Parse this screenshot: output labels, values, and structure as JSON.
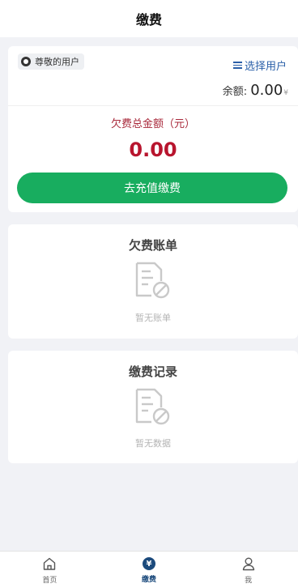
{
  "header": {
    "title": "缴费"
  },
  "account": {
    "user_name": "尊敬的用户",
    "select_user_label": "选择用户",
    "balance_label": "余额:",
    "balance_value": "0.00",
    "balance_unit": "¥",
    "arrears_label": "欠费总金额（元）",
    "arrears_value": "0.00",
    "pay_button_label": "去充值缴费"
  },
  "bills": {
    "title": "欠费账单",
    "empty_text": "暂无账单",
    "icon": "empty-document-icon"
  },
  "records": {
    "title": "缴费记录",
    "empty_text": "暂无数据",
    "icon": "empty-document-icon"
  },
  "tabbar": {
    "items": [
      {
        "label": "首页",
        "icon": "home-icon",
        "active": false
      },
      {
        "label": "缴费",
        "icon": "yen-icon",
        "active": true
      },
      {
        "label": "我",
        "icon": "user-icon",
        "active": false
      }
    ]
  },
  "colors": {
    "primary_green": "#18ad5f",
    "arrears_red": "#b8152e",
    "link_blue": "#2a5fa8",
    "active_tab": "#1b4a7c"
  }
}
